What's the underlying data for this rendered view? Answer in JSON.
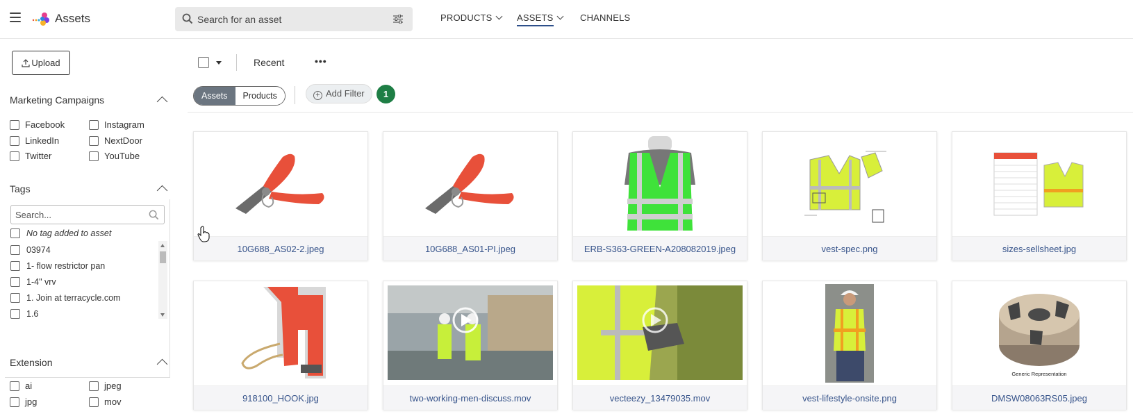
{
  "app": {
    "title": "Assets"
  },
  "search": {
    "placeholder": "Search for an asset"
  },
  "nav": [
    {
      "label": "PRODUCTS",
      "dropdown": true,
      "active": false
    },
    {
      "label": "ASSETS",
      "dropdown": true,
      "active": true
    },
    {
      "label": "CHANNELS",
      "dropdown": false,
      "active": false
    }
  ],
  "sidebar": {
    "upload_label": "Upload",
    "marketing": {
      "title": "Marketing Campaigns",
      "items": [
        "Facebook",
        "Instagram",
        "LinkedIn",
        "NextDoor",
        "Twitter",
        "YouTube"
      ]
    },
    "tags": {
      "title": "Tags",
      "search_placeholder": "Search...",
      "items": [
        "No tag added to asset",
        "03974",
        "1- flow restrictor pan",
        "1-4\" vrv",
        "1. Join at terracycle.com",
        "1.6"
      ]
    },
    "extension": {
      "title": "Extension",
      "items": [
        "ai",
        "jpeg",
        "jpg",
        "mov"
      ]
    }
  },
  "toolbar": {
    "sort_label": "Recent",
    "more_label": "•••",
    "segments": [
      "Assets",
      "Products"
    ],
    "add_filter_label": "Add Filter",
    "filter_count": "1"
  },
  "assets": [
    {
      "name": "10G688_AS02-2.jpeg"
    },
    {
      "name": "10G688_AS01-PI.jpeg"
    },
    {
      "name": "ERB-S363-GREEN-A208082019.jpeg"
    },
    {
      "name": "vest-spec.png"
    },
    {
      "name": "sizes-sellsheet.jpg"
    },
    {
      "name": "918100_HOOK.jpg"
    },
    {
      "name": "two-working-men-discuss.mov"
    },
    {
      "name": "vecteezy_13479035.mov"
    },
    {
      "name": "vest-lifestyle-onsite.png"
    },
    {
      "name": "DMSW08063RS05.jpeg",
      "image_caption": "Generic Representation"
    }
  ],
  "colors": {
    "accent_green": "#1e7e45",
    "link_blue": "#36538a",
    "nav_underline": "#2d4f8a",
    "plier_red": "#e8503a",
    "vest_green": "#3fe23a",
    "vest_yellow": "#d8ef3a"
  }
}
